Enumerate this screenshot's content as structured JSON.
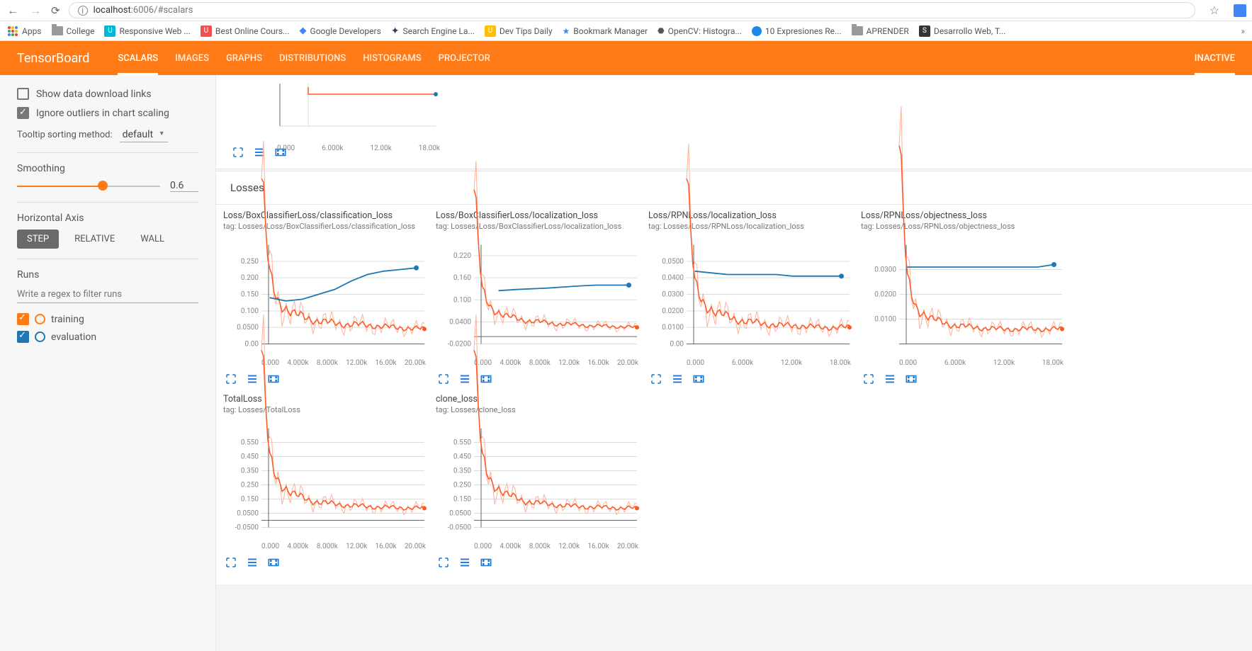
{
  "browser": {
    "url_host": "localhost",
    "url_port": ":6006",
    "url_path": "/#scalars"
  },
  "bookmarks": [
    {
      "label": "Apps",
      "icon": "grid",
      "color": ""
    },
    {
      "label": "College",
      "icon": "folder",
      "color": ""
    },
    {
      "label": "Responsive Web ...",
      "icon": "u",
      "color": "#00b8d4"
    },
    {
      "label": "Best Online Cours...",
      "icon": "u",
      "color": "#ec5252"
    },
    {
      "label": "Google Developers",
      "icon": "diamond",
      "color": ""
    },
    {
      "label": "Search Engine La...",
      "icon": "puzzle",
      "color": "#2b3a55"
    },
    {
      "label": "Dev Tips Daily",
      "icon": "U",
      "color": "#ffc107"
    },
    {
      "label": "Bookmark Manager",
      "icon": "star",
      "color": "#4285f4"
    },
    {
      "label": "OpenCV: Histogra...",
      "icon": "cv",
      "color": ""
    },
    {
      "label": "10 Expresiones Re...",
      "icon": "dot",
      "color": "#1e88e5"
    },
    {
      "label": "APRENDER",
      "icon": "folder",
      "color": ""
    },
    {
      "label": "Desarrollo Web, T...",
      "icon": "square",
      "color": "#333"
    }
  ],
  "header": {
    "logo": "TensorBoard",
    "tabs": [
      "SCALARS",
      "IMAGES",
      "GRAPHS",
      "DISTRIBUTIONS",
      "HISTOGRAMS",
      "PROJECTOR"
    ],
    "inactive": "INACTIVE"
  },
  "sidebar": {
    "show_dl": "Show data download links",
    "ignore_outliers": "Ignore outliers in chart scaling",
    "tooltip_label": "Tooltip sorting method:",
    "tooltip_value": "default",
    "smoothing_label": "Smoothing",
    "smoothing_value": "0.6",
    "haxis_label": "Horizontal Axis",
    "haxis_opts": [
      "STEP",
      "RELATIVE",
      "WALL"
    ],
    "runs_label": "Runs",
    "runs_filter_ph": "Write a regex to filter runs",
    "runs": [
      {
        "name": "training",
        "color": "orange"
      },
      {
        "name": "evaluation",
        "color": "blue"
      }
    ]
  },
  "top_chart": {
    "x_ticks": [
      "0.000",
      "6.000k",
      "12.00k",
      "18.00k"
    ]
  },
  "section": "Losses",
  "chart_data": [
    {
      "title": "Loss/BoxClassifierLoss/classification_loss",
      "tag": "tag: Losses/Loss/BoxClassifierLoss/classification_loss",
      "type": "line",
      "xlabel": "",
      "ylabel": "",
      "x_ticks": [
        "0.000",
        "4.000k",
        "8.000k",
        "12.00k",
        "16.00k",
        "20.00k"
      ],
      "y_ticks": [
        "0.00",
        "0.0500",
        "0.100",
        "0.150",
        "0.200",
        "0.250"
      ],
      "ylim": [
        0,
        0.3
      ],
      "series": [
        {
          "name": "training",
          "x": [
            0,
            1000,
            2000,
            4000,
            6000,
            8000,
            10000,
            12000,
            14000,
            16000,
            18000,
            20000
          ],
          "values": [
            0.5,
            0.2,
            0.13,
            0.09,
            0.075,
            0.065,
            0.06,
            0.058,
            0.055,
            0.05,
            0.048,
            0.045
          ]
        },
        {
          "name": "evaluation",
          "x": [
            1000,
            3000,
            5000,
            7000,
            9000,
            11000,
            13000,
            15000,
            17000,
            19000
          ],
          "values": [
            0.14,
            0.13,
            0.135,
            0.15,
            0.165,
            0.19,
            0.21,
            0.22,
            0.225,
            0.23
          ]
        }
      ]
    },
    {
      "title": "Loss/BoxClassifierLoss/localization_loss",
      "tag": "tag: Losses/Loss/BoxClassifierLoss/localization_loss",
      "type": "line",
      "x_ticks": [
        "0.000",
        "4.000k",
        "8.000k",
        "12.00k",
        "16.00k",
        "20.00k"
      ],
      "y_ticks": [
        "-0.0200",
        "0.0400",
        "0.100",
        "0.160",
        "0.220"
      ],
      "ylim": [
        -0.02,
        0.25
      ],
      "series": [
        {
          "name": "training",
          "x": [
            0,
            1000,
            2000,
            4000,
            6000,
            8000,
            10000,
            12000,
            14000,
            16000,
            18000,
            20000
          ],
          "values": [
            0.4,
            0.12,
            0.08,
            0.055,
            0.045,
            0.04,
            0.035,
            0.033,
            0.03,
            0.028,
            0.027,
            0.025
          ]
        },
        {
          "name": "evaluation",
          "x": [
            3000,
            5000,
            7000,
            9000,
            11000,
            13000,
            15000,
            17000,
            19000
          ],
          "values": [
            0.125,
            0.128,
            0.13,
            0.132,
            0.135,
            0.138,
            0.14,
            0.14,
            0.14
          ]
        }
      ]
    },
    {
      "title": "Loss/RPNLoss/localization_loss",
      "tag": "tag: Losses/Loss/RPNLoss/localization_loss",
      "type": "line",
      "x_ticks": [
        "0.000",
        "6.000k",
        "12.00k",
        "18.00k"
      ],
      "y_ticks": [
        "0.00",
        "0.0100",
        "0.0200",
        "0.0300",
        "0.0400",
        "0.0500"
      ],
      "ylim": [
        0,
        0.06
      ],
      "series": [
        {
          "name": "training",
          "x": [
            0,
            1000,
            2000,
            4000,
            6000,
            8000,
            10000,
            12000,
            14000,
            16000,
            18000,
            20000
          ],
          "values": [
            0.1,
            0.035,
            0.025,
            0.018,
            0.015,
            0.013,
            0.012,
            0.011,
            0.011,
            0.01,
            0.01,
            0.01
          ]
        },
        {
          "name": "evaluation",
          "x": [
            1000,
            3000,
            5000,
            7000,
            9000,
            11000,
            13000,
            15000,
            17000,
            19000
          ],
          "values": [
            0.044,
            0.043,
            0.042,
            0.042,
            0.042,
            0.042,
            0.041,
            0.041,
            0.041,
            0.041
          ]
        }
      ]
    },
    {
      "title": "Loss/RPNLoss/objectness_loss",
      "tag": "tag: Losses/Loss/RPNLoss/objectness_loss",
      "type": "line",
      "x_ticks": [
        "0.000",
        "6.000k",
        "12.00k",
        "18.00k"
      ],
      "y_ticks": [
        "0.0100",
        "0.0200",
        "0.0300"
      ],
      "ylim": [
        0,
        0.04
      ],
      "series": [
        {
          "name": "training",
          "x": [
            0,
            1000,
            2000,
            4000,
            6000,
            8000,
            10000,
            12000,
            14000,
            16000,
            18000,
            20000
          ],
          "values": [
            0.08,
            0.025,
            0.015,
            0.01,
            0.008,
            0.007,
            0.0065,
            0.006,
            0.006,
            0.006,
            0.006,
            0.006
          ]
        },
        {
          "name": "evaluation",
          "x": [
            1000,
            3000,
            5000,
            7000,
            9000,
            11000,
            13000,
            15000,
            17000,
            19000
          ],
          "values": [
            0.031,
            0.031,
            0.031,
            0.031,
            0.031,
            0.031,
            0.031,
            0.031,
            0.031,
            0.032
          ]
        }
      ]
    },
    {
      "title": "TotalLoss",
      "tag": "tag: Losses/TotalLoss",
      "type": "line",
      "x_ticks": [
        "0.000",
        "4.000k",
        "8.000k",
        "12.00k",
        "16.00k",
        "20.00k"
      ],
      "y_ticks": [
        "-0.0500",
        "0.0500",
        "0.150",
        "0.250",
        "0.350",
        "0.450",
        "0.550"
      ],
      "ylim": [
        -0.05,
        0.65
      ],
      "series": [
        {
          "name": "training",
          "x": [
            0,
            1000,
            2000,
            4000,
            6000,
            8000,
            10000,
            12000,
            14000,
            16000,
            18000,
            20000
          ],
          "values": [
            1.2,
            0.42,
            0.28,
            0.18,
            0.14,
            0.12,
            0.11,
            0.1,
            0.095,
            0.09,
            0.088,
            0.085
          ]
        }
      ]
    },
    {
      "title": "clone_loss",
      "tag": "tag: Losses/clone_loss",
      "type": "line",
      "x_ticks": [
        "0.000",
        "4.000k",
        "8.000k",
        "12.00k",
        "16.00k",
        "20.00k"
      ],
      "y_ticks": [
        "-0.0500",
        "0.0500",
        "0.150",
        "0.250",
        "0.350",
        "0.450",
        "0.550"
      ],
      "ylim": [
        -0.05,
        0.65
      ],
      "series": [
        {
          "name": "training",
          "x": [
            0,
            1000,
            2000,
            4000,
            6000,
            8000,
            10000,
            12000,
            14000,
            16000,
            18000,
            20000
          ],
          "values": [
            1.2,
            0.42,
            0.28,
            0.18,
            0.14,
            0.12,
            0.11,
            0.1,
            0.095,
            0.09,
            0.088,
            0.085
          ]
        }
      ]
    }
  ]
}
